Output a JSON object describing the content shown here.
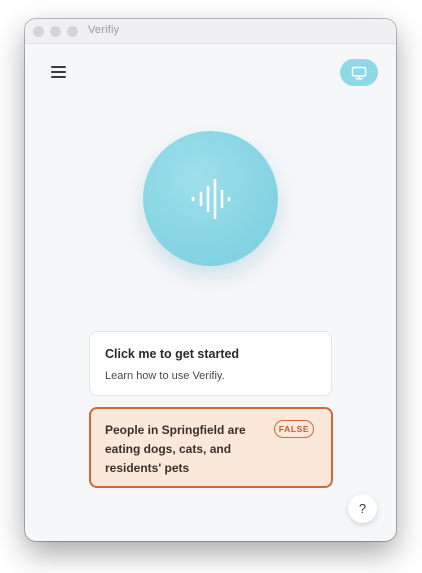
{
  "window": {
    "title": "Verifiy"
  },
  "header": {
    "menu_icon": "hamburger-menu-icon",
    "display_icon": "monitor-icon"
  },
  "mic": {
    "icon": "audio-waveform-icon"
  },
  "start_card": {
    "title": "Click me to get started",
    "subtitle": "Learn how to use Verifiy."
  },
  "claim_card": {
    "text": "People in Springfield are eating dogs, cats, and residents' pets",
    "verdict": "FALSE"
  },
  "help": {
    "label": "?"
  },
  "colors": {
    "accent": "#86d4e4",
    "false_border": "#d2683a",
    "false_bg": "#fae8da"
  }
}
